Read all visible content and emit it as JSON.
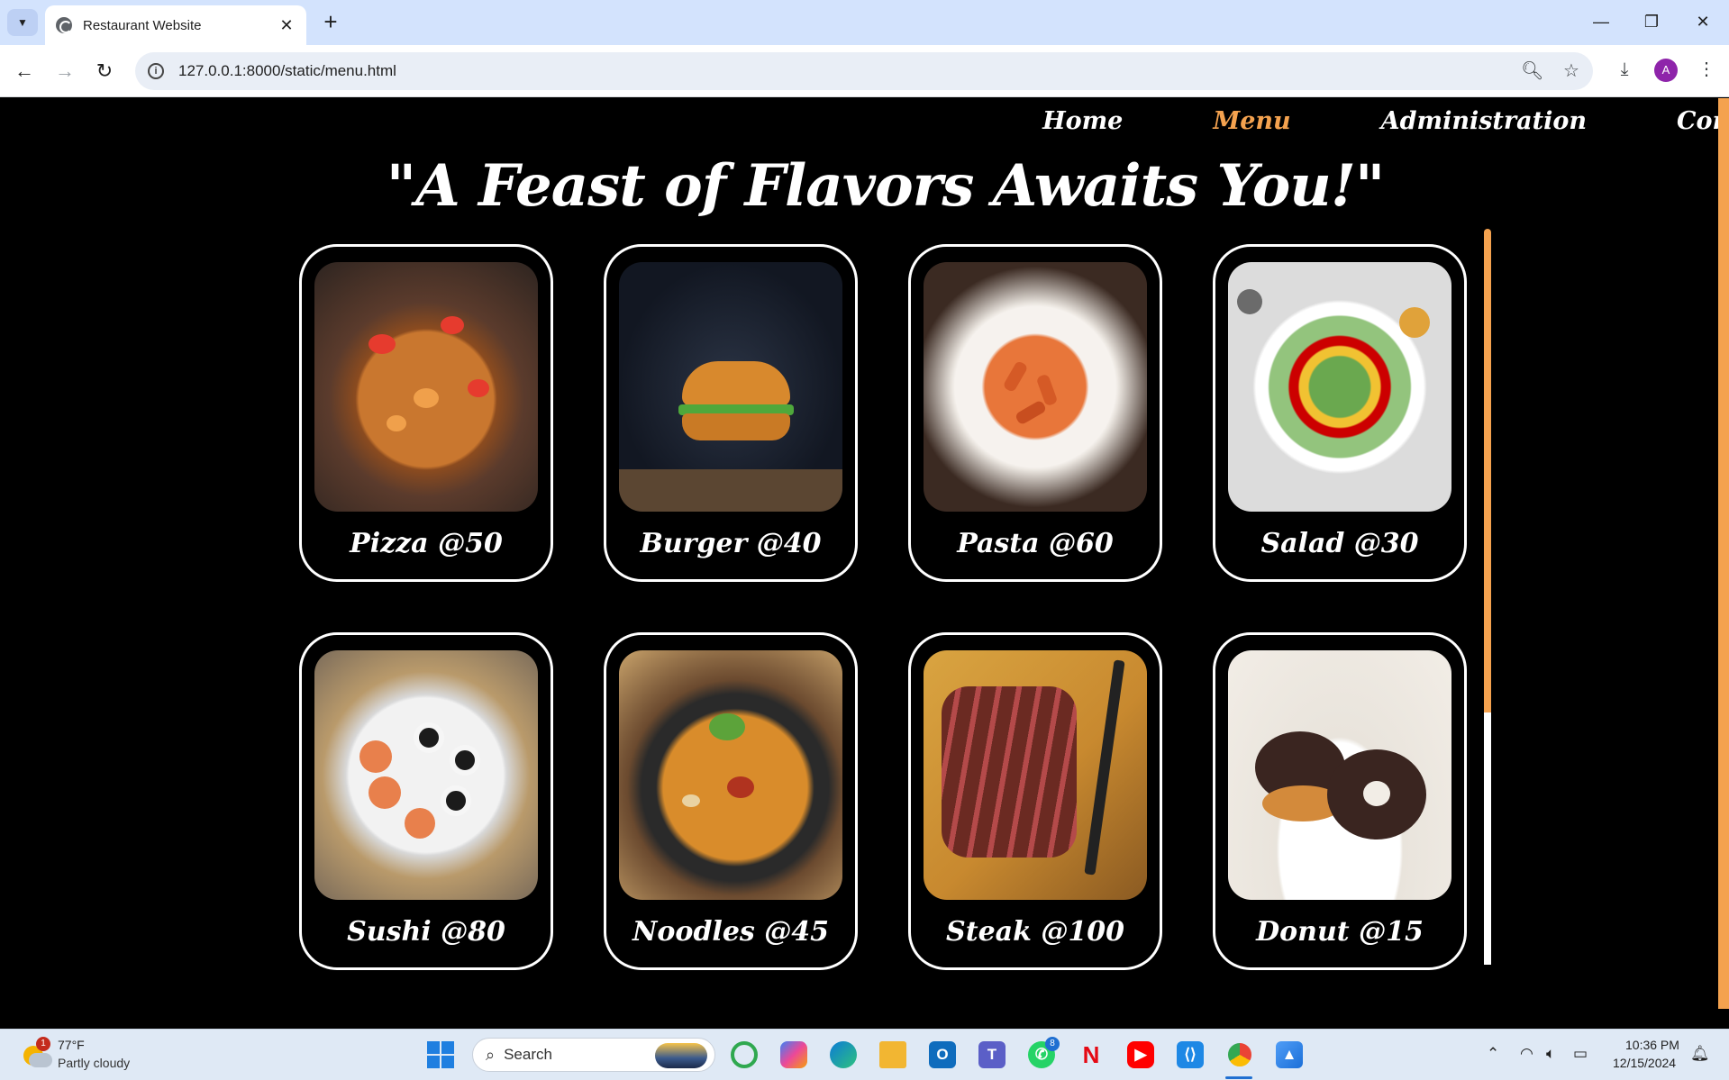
{
  "browser": {
    "tab_title": "Restaurant Website",
    "tab_close": "✕",
    "new_tab": "+",
    "url": "127.0.0.1:8000/static/menu.html",
    "profile_initial": "A"
  },
  "nav": {
    "items": [
      {
        "label": "Home",
        "active": false
      },
      {
        "label": "Menu",
        "active": true
      },
      {
        "label": "Administration",
        "active": false
      },
      {
        "label": "Contact",
        "active": false
      }
    ]
  },
  "hero_title": "\"A Feast of Flavors Awaits You!\"",
  "menu_items": [
    {
      "label": "Pizza @50",
      "image": "pizza"
    },
    {
      "label": "Burger @40",
      "image": "burger"
    },
    {
      "label": "Pasta @60",
      "image": "pasta"
    },
    {
      "label": "Salad @30",
      "image": "salad"
    },
    {
      "label": "Sushi @80",
      "image": "sushi"
    },
    {
      "label": "Noodles @45",
      "image": "noodles"
    },
    {
      "label": "Steak @100",
      "image": "steak"
    },
    {
      "label": "Donut @15",
      "image": "donut"
    }
  ],
  "taskbar": {
    "weather_temp": "77°F",
    "weather_desc": "Partly cloudy",
    "weather_badge": "1",
    "search_label": "Search",
    "whatsapp_badge": "8",
    "time": "10:36 PM",
    "date": "12/15/2024"
  },
  "colors": {
    "accent": "#f4a24f",
    "background": "#000000",
    "text": "#ffffff"
  }
}
